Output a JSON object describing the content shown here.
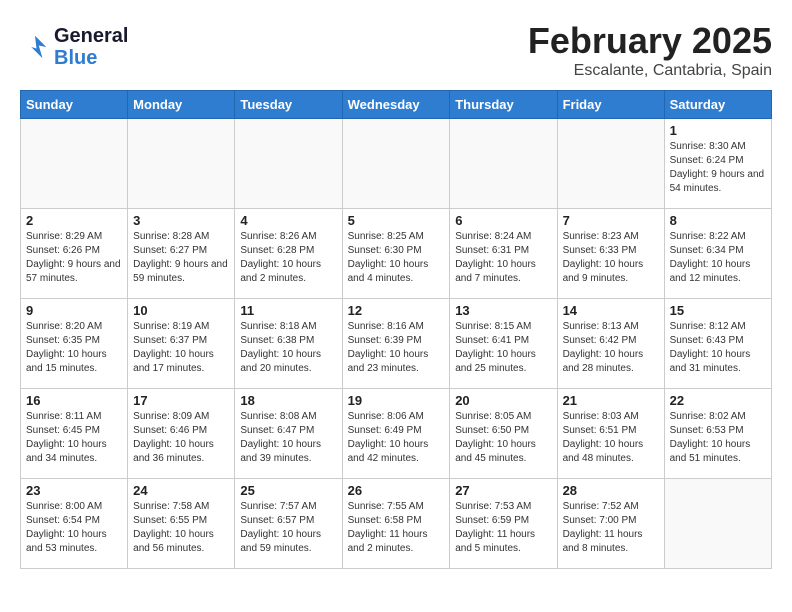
{
  "header": {
    "logo_line1": "General",
    "logo_line2": "Blue",
    "month": "February 2025",
    "location": "Escalante, Cantabria, Spain"
  },
  "weekdays": [
    "Sunday",
    "Monday",
    "Tuesday",
    "Wednesday",
    "Thursday",
    "Friday",
    "Saturday"
  ],
  "weeks": [
    [
      {
        "day": "",
        "info": ""
      },
      {
        "day": "",
        "info": ""
      },
      {
        "day": "",
        "info": ""
      },
      {
        "day": "",
        "info": ""
      },
      {
        "day": "",
        "info": ""
      },
      {
        "day": "",
        "info": ""
      },
      {
        "day": "1",
        "info": "Sunrise: 8:30 AM\nSunset: 6:24 PM\nDaylight: 9 hours and 54 minutes."
      }
    ],
    [
      {
        "day": "2",
        "info": "Sunrise: 8:29 AM\nSunset: 6:26 PM\nDaylight: 9 hours and 57 minutes."
      },
      {
        "day": "3",
        "info": "Sunrise: 8:28 AM\nSunset: 6:27 PM\nDaylight: 9 hours and 59 minutes."
      },
      {
        "day": "4",
        "info": "Sunrise: 8:26 AM\nSunset: 6:28 PM\nDaylight: 10 hours and 2 minutes."
      },
      {
        "day": "5",
        "info": "Sunrise: 8:25 AM\nSunset: 6:30 PM\nDaylight: 10 hours and 4 minutes."
      },
      {
        "day": "6",
        "info": "Sunrise: 8:24 AM\nSunset: 6:31 PM\nDaylight: 10 hours and 7 minutes."
      },
      {
        "day": "7",
        "info": "Sunrise: 8:23 AM\nSunset: 6:33 PM\nDaylight: 10 hours and 9 minutes."
      },
      {
        "day": "8",
        "info": "Sunrise: 8:22 AM\nSunset: 6:34 PM\nDaylight: 10 hours and 12 minutes."
      }
    ],
    [
      {
        "day": "9",
        "info": "Sunrise: 8:20 AM\nSunset: 6:35 PM\nDaylight: 10 hours and 15 minutes."
      },
      {
        "day": "10",
        "info": "Sunrise: 8:19 AM\nSunset: 6:37 PM\nDaylight: 10 hours and 17 minutes."
      },
      {
        "day": "11",
        "info": "Sunrise: 8:18 AM\nSunset: 6:38 PM\nDaylight: 10 hours and 20 minutes."
      },
      {
        "day": "12",
        "info": "Sunrise: 8:16 AM\nSunset: 6:39 PM\nDaylight: 10 hours and 23 minutes."
      },
      {
        "day": "13",
        "info": "Sunrise: 8:15 AM\nSunset: 6:41 PM\nDaylight: 10 hours and 25 minutes."
      },
      {
        "day": "14",
        "info": "Sunrise: 8:13 AM\nSunset: 6:42 PM\nDaylight: 10 hours and 28 minutes."
      },
      {
        "day": "15",
        "info": "Sunrise: 8:12 AM\nSunset: 6:43 PM\nDaylight: 10 hours and 31 minutes."
      }
    ],
    [
      {
        "day": "16",
        "info": "Sunrise: 8:11 AM\nSunset: 6:45 PM\nDaylight: 10 hours and 34 minutes."
      },
      {
        "day": "17",
        "info": "Sunrise: 8:09 AM\nSunset: 6:46 PM\nDaylight: 10 hours and 36 minutes."
      },
      {
        "day": "18",
        "info": "Sunrise: 8:08 AM\nSunset: 6:47 PM\nDaylight: 10 hours and 39 minutes."
      },
      {
        "day": "19",
        "info": "Sunrise: 8:06 AM\nSunset: 6:49 PM\nDaylight: 10 hours and 42 minutes."
      },
      {
        "day": "20",
        "info": "Sunrise: 8:05 AM\nSunset: 6:50 PM\nDaylight: 10 hours and 45 minutes."
      },
      {
        "day": "21",
        "info": "Sunrise: 8:03 AM\nSunset: 6:51 PM\nDaylight: 10 hours and 48 minutes."
      },
      {
        "day": "22",
        "info": "Sunrise: 8:02 AM\nSunset: 6:53 PM\nDaylight: 10 hours and 51 minutes."
      }
    ],
    [
      {
        "day": "23",
        "info": "Sunrise: 8:00 AM\nSunset: 6:54 PM\nDaylight: 10 hours and 53 minutes."
      },
      {
        "day": "24",
        "info": "Sunrise: 7:58 AM\nSunset: 6:55 PM\nDaylight: 10 hours and 56 minutes."
      },
      {
        "day": "25",
        "info": "Sunrise: 7:57 AM\nSunset: 6:57 PM\nDaylight: 10 hours and 59 minutes."
      },
      {
        "day": "26",
        "info": "Sunrise: 7:55 AM\nSunset: 6:58 PM\nDaylight: 11 hours and 2 minutes."
      },
      {
        "day": "27",
        "info": "Sunrise: 7:53 AM\nSunset: 6:59 PM\nDaylight: 11 hours and 5 minutes."
      },
      {
        "day": "28",
        "info": "Sunrise: 7:52 AM\nSunset: 7:00 PM\nDaylight: 11 hours and 8 minutes."
      },
      {
        "day": "",
        "info": ""
      }
    ]
  ]
}
